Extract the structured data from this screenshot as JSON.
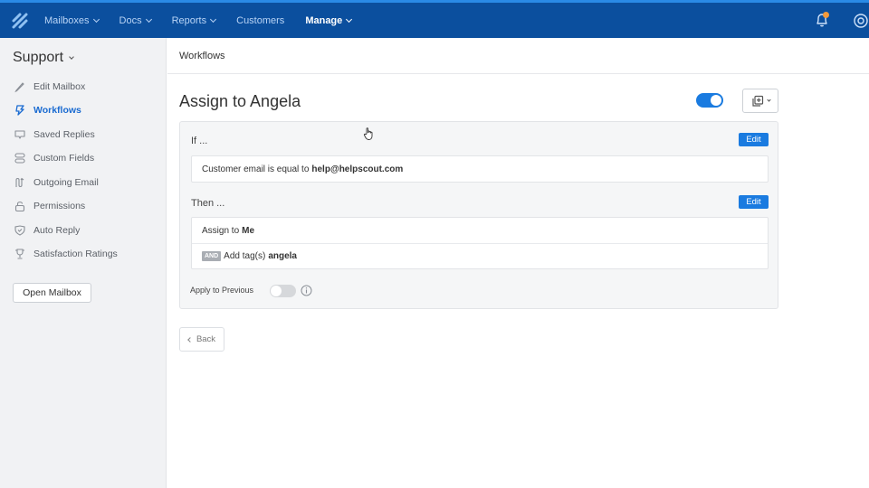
{
  "topnav": {
    "logo": "helpscout-logo-icon",
    "items": [
      {
        "label": "Mailboxes",
        "has_dropdown": true
      },
      {
        "label": "Docs",
        "has_dropdown": true
      },
      {
        "label": "Reports",
        "has_dropdown": true
      },
      {
        "label": "Customers",
        "has_dropdown": false
      },
      {
        "label": "Manage",
        "has_dropdown": true,
        "active": true
      }
    ],
    "notification_icon": "bell-icon",
    "notification_badge_color": "#f39a3c",
    "help_icon": "lifebuoy-icon"
  },
  "sidebar": {
    "mailbox_name": "Support",
    "items": [
      {
        "label": "Edit Mailbox",
        "icon": "pencil-icon"
      },
      {
        "label": "Workflows",
        "icon": "lightning-icon",
        "active": true
      },
      {
        "label": "Saved Replies",
        "icon": "speech-bubble-icon"
      },
      {
        "label": "Custom Fields",
        "icon": "fields-icon"
      },
      {
        "label": "Outgoing Email",
        "icon": "outgoing-email-icon"
      },
      {
        "label": "Permissions",
        "icon": "lock-icon"
      },
      {
        "label": "Auto Reply",
        "icon": "shield-check-icon"
      },
      {
        "label": "Satisfaction Ratings",
        "icon": "trophy-icon"
      }
    ],
    "open_mailbox_label": "Open Mailbox"
  },
  "main": {
    "breadcrumb": "Workflows",
    "title": "Assign to Angela",
    "workflow_enabled": true,
    "copy_icon": "copy-plus-icon",
    "if_section": {
      "label": "If ...",
      "edit_label": "Edit",
      "conditions": [
        {
          "text": "Customer email is equal to",
          "value": "help@helpscout.com"
        }
      ]
    },
    "then_section": {
      "label": "Then ...",
      "edit_label": "Edit",
      "actions": [
        {
          "prefix": "",
          "text": "Assign to",
          "value": "Me"
        },
        {
          "prefix": "AND",
          "text": "Add tag(s)",
          "value": "angela"
        }
      ]
    },
    "apply_previous": {
      "label": "Apply to Previous",
      "enabled": false
    },
    "back_label": "Back"
  },
  "colors": {
    "topbar": "#0b4f9e",
    "accent": "#1a7be0",
    "active_link": "#1a6bd1",
    "sidebar_bg": "#f1f2f4"
  }
}
